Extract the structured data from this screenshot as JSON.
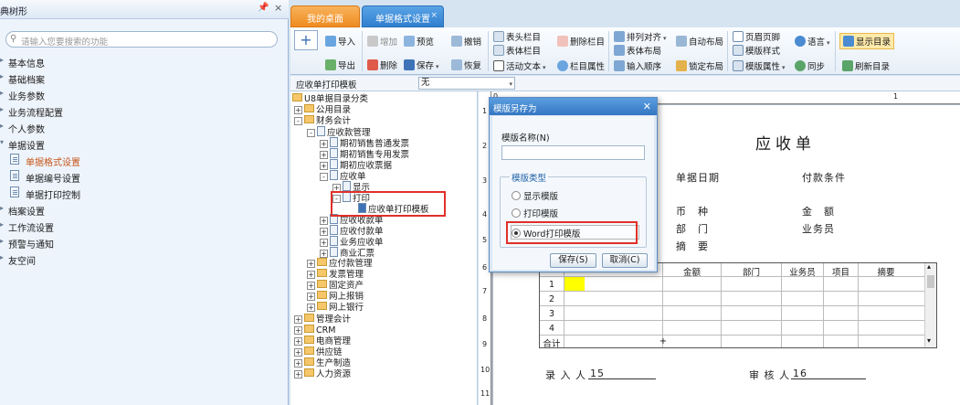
{
  "left_panel": {
    "title": "经典树形",
    "pin": "📌",
    "close": "×",
    "search_placeholder": "请输入您要搜索的功能",
    "nav_items": [
      {
        "label": "基本信息",
        "arrow": "▸"
      },
      {
        "label": "基础档案",
        "arrow": "▸"
      },
      {
        "label": "业务参数",
        "arrow": "▸"
      },
      {
        "label": "业务流程配置",
        "arrow": "▸"
      },
      {
        "label": "个人参数",
        "arrow": "▸"
      },
      {
        "label": "单据设置",
        "arrow": "▾"
      },
      {
        "label": "单据格式设置"
      },
      {
        "label": "单据编号设置"
      },
      {
        "label": "单据打印控制"
      },
      {
        "label": "档案设置",
        "arrow": "▸"
      },
      {
        "label": "工作流设置",
        "arrow": "▸"
      },
      {
        "label": "预警与通知",
        "arrow": "▸"
      },
      {
        "label": "友空间",
        "arrow": "▸"
      }
    ]
  },
  "tabs": [
    {
      "label": "我的桌面"
    },
    {
      "label": "单据格式设置",
      "close": "×"
    }
  ],
  "toolbar": {
    "import": "导入",
    "export": "导出",
    "add": "增加",
    "delete": "删除",
    "preview": "预览",
    "save": "保存",
    "undo": "撤销",
    "restore": "恢复",
    "header_col": "表头栏目",
    "body_col": "表体栏目",
    "active_text": "活动文本",
    "delete_col": "删除栏目",
    "col_props": "栏目属性",
    "arrange_align": "排列对齐",
    "body_layout": "表体布局",
    "input_order": "输入顺序",
    "auto_layout": "自动布局",
    "lock_layout": "锁定布局",
    "page_header_footer": "页眉页脚",
    "template_style": "模版样式",
    "template_props": "模版属性",
    "language": "语言",
    "sync": "同步",
    "show_catalog": "显示目录",
    "refresh_catalog": "刷新目录",
    "dropdown": "▾"
  },
  "template_row": {
    "label": "应收单打印模板",
    "value": "无"
  },
  "tree": [
    {
      "label": "U8单据目录分类",
      "type": "folder"
    },
    {
      "label": "公用目录",
      "type": "folder",
      "pm": "+"
    },
    {
      "label": "财务会计",
      "type": "folder",
      "pm": "-"
    },
    {
      "label": "应收款管理",
      "type": "doc",
      "pm": "-"
    },
    {
      "label": "期初销售普通发票",
      "type": "doc",
      "pm": "+"
    },
    {
      "label": "期初销售专用发票",
      "type": "doc",
      "pm": "+"
    },
    {
      "label": "期初应收票据",
      "type": "doc",
      "pm": "+"
    },
    {
      "label": "应收单",
      "type": "doc",
      "pm": "-"
    },
    {
      "label": "显示",
      "type": "doc",
      "pm": "+"
    },
    {
      "label": "打印",
      "type": "doc",
      "pm": "-"
    },
    {
      "label": "应收单打印模板",
      "type": "leaf"
    },
    {
      "label": "应收收款单",
      "type": "doc",
      "pm": "+"
    },
    {
      "label": "应收付款单",
      "type": "doc",
      "pm": "+"
    },
    {
      "label": "业务应收单",
      "type": "doc",
      "pm": "+"
    },
    {
      "label": "商业汇票",
      "type": "doc",
      "pm": "+"
    },
    {
      "label": "应付款管理",
      "type": "folder",
      "pm": "+"
    },
    {
      "label": "发票管理",
      "type": "folder",
      "pm": "+"
    },
    {
      "label": "固定资产",
      "type": "folder",
      "pm": "+"
    },
    {
      "label": "网上报销",
      "type": "folder",
      "pm": "+"
    },
    {
      "label": "网上银行",
      "type": "folder",
      "pm": "+"
    },
    {
      "label": "管理会计",
      "type": "folder",
      "pm": "+"
    },
    {
      "label": "CRM",
      "type": "folder",
      "pm": "+"
    },
    {
      "label": "电商管理",
      "type": "folder",
      "pm": "+"
    },
    {
      "label": "供应链",
      "type": "folder",
      "pm": "+"
    },
    {
      "label": "生产制造",
      "type": "folder",
      "pm": "+"
    },
    {
      "label": "人力资源",
      "type": "folder",
      "pm": "+"
    }
  ],
  "document": {
    "title": "应收单",
    "bill_date": "单据日期",
    "payment_terms": "付款条件",
    "currency": "币　种",
    "amount": "金　额",
    "department": "部　门",
    "salesperson": "业务员",
    "summary": "摘　要",
    "grid_headers": [
      "金额",
      "部门",
      "业务员",
      "项目",
      "摘要"
    ],
    "grid_rows": [
      "1",
      "2",
      "3",
      "4"
    ],
    "grid_total": "合计",
    "grid_plus": "+",
    "entered_by_label": "录 入 人",
    "entered_by": "15",
    "reviewer_label": "审 核 人",
    "reviewer": "16",
    "ruler_h": [
      "0",
      "1"
    ],
    "ruler_v": [
      "1",
      "2",
      "3",
      "4",
      "5",
      "6",
      "7",
      "8",
      "9",
      "10",
      "11"
    ]
  },
  "dialog": {
    "title": "模版另存为",
    "close": "✕",
    "name_label": "模版名称(N)",
    "name_value": "",
    "type_group": "模版类型",
    "options": [
      "显示模版",
      "打印模版",
      "Word打印模版"
    ],
    "selected": "Word打印模版",
    "save": "保存(S)",
    "cancel": "取消(C)"
  }
}
